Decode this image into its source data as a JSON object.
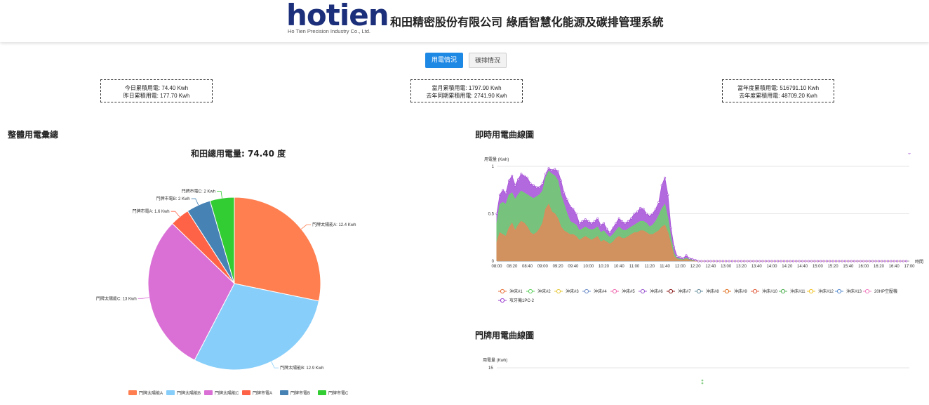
{
  "header": {
    "logo_text": "hotien",
    "logo_sub": "Ho Tien Precision Industry Co., Ltd.",
    "title": "和田精密股份有限公司 綠盾智慧化能源及碳排管理系統"
  },
  "tabs": [
    {
      "label": "用電情況",
      "active": true
    },
    {
      "label": "碳排情況",
      "active": false
    }
  ],
  "stats": [
    {
      "line1": "今日累積用電: 74.40 Kwh",
      "line2": "昨日累積用電: 177.70 Kwh"
    },
    {
      "line1": "當月累積用電: 1797.90 Kwh",
      "line2": "去年同期累積用電: 2741.90 Kwh"
    },
    {
      "line1": "當年度累積用電: 516791.10 Kwh",
      "line2": "去年度累積用電: 48709.20 Kwh"
    }
  ],
  "sections": {
    "overall": "整體用電彙總",
    "realtime": "即時用電曲線圖",
    "door": "門牌用電曲線圖"
  },
  "pie_title": "和田總用電量: 74.40 度",
  "colors": {
    "accent": "#1e88e5",
    "logo": "#1c2f7a"
  },
  "chart_data": [
    {
      "type": "pie",
      "title": "和田總用電量: 74.40 度",
      "slices": [
        {
          "label": "門牌太陽能A",
          "value": 12.4,
          "unit": "Kwh",
          "color": "#ff7f50",
          "label_text": "門牌太陽能A: 12.4 Kwh"
        },
        {
          "label": "門牌太陽能B",
          "value": 12.9,
          "unit": "Kwh",
          "color": "#87cefa",
          "label_text": "門牌太陽能B: 12.9 Kwh"
        },
        {
          "label": "門牌太陽能C",
          "value": 13,
          "unit": "Kwh",
          "color": "#da70d6",
          "label_text": "門牌太陽能C: 13 Kwh"
        },
        {
          "label": "門牌市電A",
          "value": 1.6,
          "unit": "Kwh",
          "color": "#ff6347",
          "label_text": "門牌市電A: 1.6 Kwh"
        },
        {
          "label": "門牌市電B",
          "value": 2,
          "unit": "Kwh",
          "color": "#4682b4",
          "label_text": "門牌市電B: 2 Kwh"
        },
        {
          "label": "門牌市電C",
          "value": 2,
          "unit": "Kwh",
          "color": "#32cd32",
          "label_text": "門牌市電C: 2 Kwh"
        }
      ],
      "legend": [
        "門牌太陽能A",
        "門牌太陽能B",
        "門牌太陽能C",
        "門牌市電A",
        "門牌市電B",
        "門牌市電C"
      ]
    },
    {
      "type": "area",
      "ylabel": "用電量 (Kwh)",
      "xlabel": "時間",
      "ylim": [
        0,
        1
      ],
      "yticks": [
        "0",
        "0.5",
        "1"
      ],
      "x_ticks": [
        "08:00",
        "08:20",
        "08:40",
        "09:00",
        "09:20",
        "09:40",
        "10:00",
        "10:20",
        "10:40",
        "11:00",
        "11:20",
        "11:40",
        "12:00",
        "12:20",
        "12:40",
        "13:00",
        "13:20",
        "13:40",
        "14:00",
        "14:20",
        "14:40",
        "15:00",
        "15:20",
        "15:40",
        "16:00",
        "16:20",
        "16:40",
        "17:00"
      ],
      "series": [
        {
          "name": "沖床#1",
          "color": "#e8703a"
        },
        {
          "name": "沖床#2",
          "color": "#5bcf5b"
        },
        {
          "name": "沖床#3",
          "color": "#e6c83a"
        },
        {
          "name": "沖床#4",
          "color": "#6c8ec9"
        },
        {
          "name": "沖床#5",
          "color": "#f06ab0"
        },
        {
          "name": "沖床#6",
          "color": "#9b59d0"
        },
        {
          "name": "沖床#7",
          "color": "#8b1a1a"
        },
        {
          "name": "沖床#8",
          "color": "#6a8fa0"
        },
        {
          "name": "沖床#9",
          "color": "#e07020"
        },
        {
          "name": "沖床#10",
          "color": "#e05a3a"
        },
        {
          "name": "沖床#11",
          "color": "#4caf50"
        },
        {
          "name": "沖床#12",
          "color": "#f0c020"
        },
        {
          "name": "沖床#13",
          "color": "#5a8fd0"
        },
        {
          "name": "20HP空壓機",
          "color": "#f080c0"
        },
        {
          "name": "攻牙機1PC-2",
          "color": "#9b3fd0"
        }
      ],
      "stack_totals": {
        "x": [
          0,
          0.2,
          0.4,
          0.6,
          0.8,
          1,
          1.2,
          1.4,
          1.6,
          1.8,
          2,
          2.2,
          2.4,
          2.6,
          2.8,
          3,
          3.2,
          3.4,
          3.6,
          3.8,
          4,
          4.2,
          4.4,
          4.6,
          4.8,
          5,
          5.2,
          5.4,
          5.6,
          5.8,
          6,
          6.2,
          6.4,
          6.6,
          6.8,
          7,
          7.2,
          7.4,
          7.6,
          7.8,
          8,
          8.2,
          8.4,
          8.6,
          8.8,
          9,
          9.2,
          9.4,
          9.6,
          9.8,
          10,
          10.2,
          10.4,
          10.6,
          10.8,
          11,
          11.2,
          11.4,
          11.6,
          11.8,
          12,
          12.2,
          12.4,
          12.6,
          12.8,
          13,
          13.2,
          13.4,
          13.6,
          13.8,
          14,
          14.2,
          14.4,
          14.6,
          14.8,
          15,
          15.2,
          15.4,
          15.6,
          15.8,
          16,
          16.2,
          16.4,
          16.6,
          16.8,
          17,
          17.2,
          17.4,
          17.6,
          17.8,
          18,
          18.2,
          18.4,
          18.6,
          18.8,
          19,
          19.2,
          19.4,
          19.6,
          19.8,
          20,
          20.2,
          20.4,
          20.6,
          20.8,
          21,
          21.2,
          21.4,
          21.6,
          21.8,
          22,
          22.2,
          22.4,
          22.6,
          22.8,
          23,
          23.2,
          23.4,
          23.6,
          23.8,
          24,
          24.2,
          24.4,
          24.6,
          24.8,
          25,
          25.2,
          25.4,
          25.6,
          25.8,
          26,
          26.2,
          26.4,
          26.6,
          26.8,
          27
        ],
        "purple": [
          0.5,
          0.7,
          0.75,
          0.72,
          0.85,
          0.9,
          0.8,
          0.86,
          0.92,
          0.9,
          0.88,
          0.82,
          0.8,
          0.78,
          0.78,
          0.82,
          0.92,
          0.98,
          0.96,
          0.97,
          0.95,
          0.85,
          0.72,
          0.65,
          0.58,
          0.55,
          0.5,
          0.4,
          0.42,
          0.44,
          0.42,
          0.4,
          0.42,
          0.45,
          0.38,
          0.4,
          0.34,
          0.3,
          0.35,
          0.4,
          0.45,
          0.42,
          0.4,
          0.42,
          0.45,
          0.5,
          0.52,
          0.56,
          0.55,
          0.5,
          0.48,
          0.5,
          0.55,
          0.62,
          0.8,
          0.88,
          0.7,
          0.35,
          0.15,
          0.05,
          0.04,
          0.03,
          0.06,
          0.03,
          0.02,
          0.01,
          0.0,
          0.0,
          0.0,
          0.0,
          0.0,
          0.0,
          0.0,
          0.0,
          0.0,
          0.0,
          0.0,
          0.0,
          0.0,
          0.0,
          0.0,
          0.0,
          0.0,
          0.0,
          0.0,
          0.0,
          0.0,
          0.0,
          0.0,
          0.0,
          0.0,
          0.0,
          0.0,
          0.0,
          0.0,
          0.0,
          0.0,
          0.0,
          0.0,
          0.0,
          0.0,
          0.0,
          0.0,
          0.0,
          0.0,
          0.0,
          0.0,
          0.0,
          0.0,
          0.0,
          0.0,
          0.0,
          0.0,
          0.0,
          0.0,
          0.0,
          0.0,
          0.0,
          0.0,
          0.0,
          0.0,
          0.0,
          0.0,
          0.0,
          0.0,
          0.0,
          0.0,
          0.0,
          0.0,
          0.0,
          0.0,
          0.0,
          0.0,
          0.0,
          0.0
        ],
        "green": [
          0.4,
          0.6,
          0.62,
          0.6,
          0.7,
          0.72,
          0.65,
          0.7,
          0.74,
          0.72,
          0.7,
          0.68,
          0.66,
          0.68,
          0.7,
          0.74,
          0.88,
          0.95,
          0.92,
          0.9,
          0.85,
          0.7,
          0.6,
          0.5,
          0.42,
          0.4,
          0.38,
          0.32,
          0.34,
          0.36,
          0.34,
          0.33,
          0.34,
          0.36,
          0.3,
          0.32,
          0.28,
          0.25,
          0.28,
          0.32,
          0.36,
          0.33,
          0.32,
          0.34,
          0.36,
          0.38,
          0.4,
          0.42,
          0.42,
          0.4,
          0.36,
          0.38,
          0.42,
          0.48,
          0.55,
          0.6,
          0.45,
          0.25,
          0.08,
          0.03,
          0.02,
          0.02,
          0.03,
          0.02,
          0.01,
          0.0,
          0.0,
          0.0,
          0.0,
          0.0,
          0.0,
          0.0,
          0.0,
          0.0,
          0.0,
          0.0,
          0.0,
          0.0,
          0.0,
          0.0,
          0.0,
          0.0,
          0.0,
          0.0,
          0.0,
          0.0,
          0.0,
          0.0,
          0.0,
          0.0,
          0.0,
          0.0,
          0.0,
          0.0,
          0.0,
          0.0,
          0.0,
          0.0,
          0.0,
          0.0,
          0.0,
          0.0,
          0.0,
          0.0,
          0.0,
          0.0,
          0.0,
          0.0,
          0.0,
          0.0,
          0.0,
          0.0,
          0.0,
          0.0,
          0.0,
          0.0,
          0.0,
          0.0,
          0.0,
          0.0,
          0.0,
          0.0,
          0.0,
          0.0,
          0.0,
          0.0,
          0.0,
          0.0,
          0.0,
          0.0,
          0.0,
          0.0,
          0.0,
          0.0,
          0.0
        ],
        "orange": [
          0.2,
          0.3,
          0.28,
          0.26,
          0.35,
          0.4,
          0.32,
          0.38,
          0.42,
          0.4,
          0.36,
          0.3,
          0.28,
          0.3,
          0.34,
          0.4,
          0.55,
          0.6,
          0.52,
          0.5,
          0.45,
          0.36,
          0.32,
          0.3,
          0.28,
          0.28,
          0.26,
          0.22,
          0.24,
          0.26,
          0.24,
          0.22,
          0.24,
          0.26,
          0.2,
          0.22,
          0.2,
          0.18,
          0.2,
          0.24,
          0.26,
          0.24,
          0.24,
          0.26,
          0.28,
          0.3,
          0.3,
          0.32,
          0.32,
          0.3,
          0.28,
          0.28,
          0.3,
          0.32,
          0.36,
          0.38,
          0.3,
          0.18,
          0.05,
          0.02,
          0.01,
          0.01,
          0.02,
          0.01,
          0.0,
          0.0,
          0.0,
          0.0,
          0.0,
          0.0,
          0.0,
          0.0,
          0.0,
          0.0,
          0.0,
          0.0,
          0.0,
          0.0,
          0.0,
          0.0,
          0.0,
          0.0,
          0.0,
          0.0,
          0.0,
          0.0,
          0.0,
          0.0,
          0.0,
          0.0,
          0.0,
          0.0,
          0.0,
          0.0,
          0.0,
          0.0,
          0.0,
          0.0,
          0.0,
          0.0,
          0.0,
          0.0,
          0.0,
          0.0,
          0.0,
          0.0,
          0.0,
          0.0,
          0.0,
          0.0,
          0.0,
          0.0,
          0.0,
          0.0,
          0.0,
          0.0,
          0.0,
          0.0,
          0.0,
          0.0,
          0.0,
          0.0,
          0.0,
          0.0,
          0.0,
          0.0,
          0.0,
          0.0,
          0.0,
          0.0,
          0.0,
          0.0,
          0.0,
          0.0,
          0.0
        ]
      }
    },
    {
      "type": "line",
      "ylabel": "用電量 (Kwh)",
      "yticks": [
        "15"
      ]
    }
  ]
}
